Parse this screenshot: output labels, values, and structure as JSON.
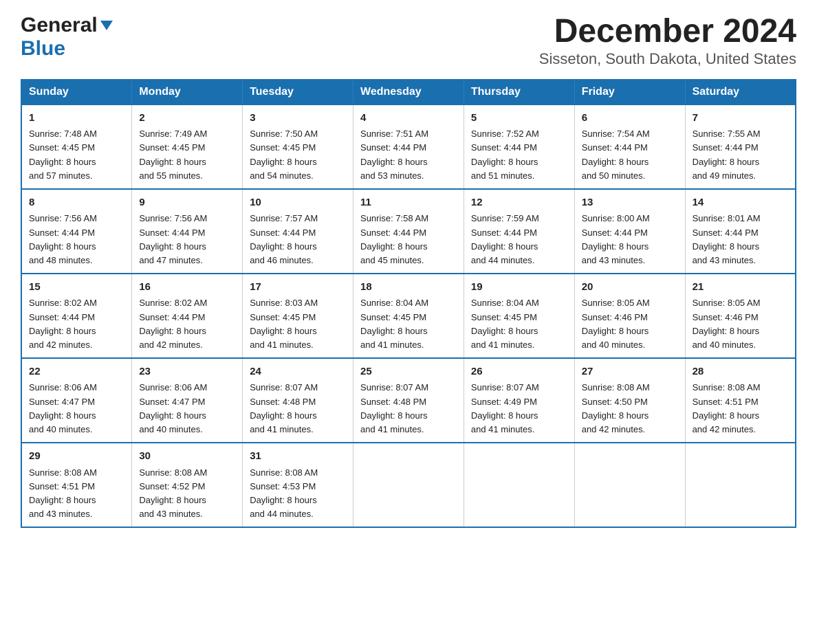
{
  "header": {
    "logo_line1": "General",
    "logo_line2": "Blue",
    "title": "December 2024",
    "subtitle": "Sisseton, South Dakota, United States"
  },
  "calendar": {
    "days_of_week": [
      "Sunday",
      "Monday",
      "Tuesday",
      "Wednesday",
      "Thursday",
      "Friday",
      "Saturday"
    ],
    "weeks": [
      [
        {
          "day": "1",
          "info": "Sunrise: 7:48 AM\nSunset: 4:45 PM\nDaylight: 8 hours\nand 57 minutes."
        },
        {
          "day": "2",
          "info": "Sunrise: 7:49 AM\nSunset: 4:45 PM\nDaylight: 8 hours\nand 55 minutes."
        },
        {
          "day": "3",
          "info": "Sunrise: 7:50 AM\nSunset: 4:45 PM\nDaylight: 8 hours\nand 54 minutes."
        },
        {
          "day": "4",
          "info": "Sunrise: 7:51 AM\nSunset: 4:44 PM\nDaylight: 8 hours\nand 53 minutes."
        },
        {
          "day": "5",
          "info": "Sunrise: 7:52 AM\nSunset: 4:44 PM\nDaylight: 8 hours\nand 51 minutes."
        },
        {
          "day": "6",
          "info": "Sunrise: 7:54 AM\nSunset: 4:44 PM\nDaylight: 8 hours\nand 50 minutes."
        },
        {
          "day": "7",
          "info": "Sunrise: 7:55 AM\nSunset: 4:44 PM\nDaylight: 8 hours\nand 49 minutes."
        }
      ],
      [
        {
          "day": "8",
          "info": "Sunrise: 7:56 AM\nSunset: 4:44 PM\nDaylight: 8 hours\nand 48 minutes."
        },
        {
          "day": "9",
          "info": "Sunrise: 7:56 AM\nSunset: 4:44 PM\nDaylight: 8 hours\nand 47 minutes."
        },
        {
          "day": "10",
          "info": "Sunrise: 7:57 AM\nSunset: 4:44 PM\nDaylight: 8 hours\nand 46 minutes."
        },
        {
          "day": "11",
          "info": "Sunrise: 7:58 AM\nSunset: 4:44 PM\nDaylight: 8 hours\nand 45 minutes."
        },
        {
          "day": "12",
          "info": "Sunrise: 7:59 AM\nSunset: 4:44 PM\nDaylight: 8 hours\nand 44 minutes."
        },
        {
          "day": "13",
          "info": "Sunrise: 8:00 AM\nSunset: 4:44 PM\nDaylight: 8 hours\nand 43 minutes."
        },
        {
          "day": "14",
          "info": "Sunrise: 8:01 AM\nSunset: 4:44 PM\nDaylight: 8 hours\nand 43 minutes."
        }
      ],
      [
        {
          "day": "15",
          "info": "Sunrise: 8:02 AM\nSunset: 4:44 PM\nDaylight: 8 hours\nand 42 minutes."
        },
        {
          "day": "16",
          "info": "Sunrise: 8:02 AM\nSunset: 4:44 PM\nDaylight: 8 hours\nand 42 minutes."
        },
        {
          "day": "17",
          "info": "Sunrise: 8:03 AM\nSunset: 4:45 PM\nDaylight: 8 hours\nand 41 minutes."
        },
        {
          "day": "18",
          "info": "Sunrise: 8:04 AM\nSunset: 4:45 PM\nDaylight: 8 hours\nand 41 minutes."
        },
        {
          "day": "19",
          "info": "Sunrise: 8:04 AM\nSunset: 4:45 PM\nDaylight: 8 hours\nand 41 minutes."
        },
        {
          "day": "20",
          "info": "Sunrise: 8:05 AM\nSunset: 4:46 PM\nDaylight: 8 hours\nand 40 minutes."
        },
        {
          "day": "21",
          "info": "Sunrise: 8:05 AM\nSunset: 4:46 PM\nDaylight: 8 hours\nand 40 minutes."
        }
      ],
      [
        {
          "day": "22",
          "info": "Sunrise: 8:06 AM\nSunset: 4:47 PM\nDaylight: 8 hours\nand 40 minutes."
        },
        {
          "day": "23",
          "info": "Sunrise: 8:06 AM\nSunset: 4:47 PM\nDaylight: 8 hours\nand 40 minutes."
        },
        {
          "day": "24",
          "info": "Sunrise: 8:07 AM\nSunset: 4:48 PM\nDaylight: 8 hours\nand 41 minutes."
        },
        {
          "day": "25",
          "info": "Sunrise: 8:07 AM\nSunset: 4:48 PM\nDaylight: 8 hours\nand 41 minutes."
        },
        {
          "day": "26",
          "info": "Sunrise: 8:07 AM\nSunset: 4:49 PM\nDaylight: 8 hours\nand 41 minutes."
        },
        {
          "day": "27",
          "info": "Sunrise: 8:08 AM\nSunset: 4:50 PM\nDaylight: 8 hours\nand 42 minutes."
        },
        {
          "day": "28",
          "info": "Sunrise: 8:08 AM\nSunset: 4:51 PM\nDaylight: 8 hours\nand 42 minutes."
        }
      ],
      [
        {
          "day": "29",
          "info": "Sunrise: 8:08 AM\nSunset: 4:51 PM\nDaylight: 8 hours\nand 43 minutes."
        },
        {
          "day": "30",
          "info": "Sunrise: 8:08 AM\nSunset: 4:52 PM\nDaylight: 8 hours\nand 43 minutes."
        },
        {
          "day": "31",
          "info": "Sunrise: 8:08 AM\nSunset: 4:53 PM\nDaylight: 8 hours\nand 44 minutes."
        },
        {
          "day": "",
          "info": ""
        },
        {
          "day": "",
          "info": ""
        },
        {
          "day": "",
          "info": ""
        },
        {
          "day": "",
          "info": ""
        }
      ]
    ]
  }
}
